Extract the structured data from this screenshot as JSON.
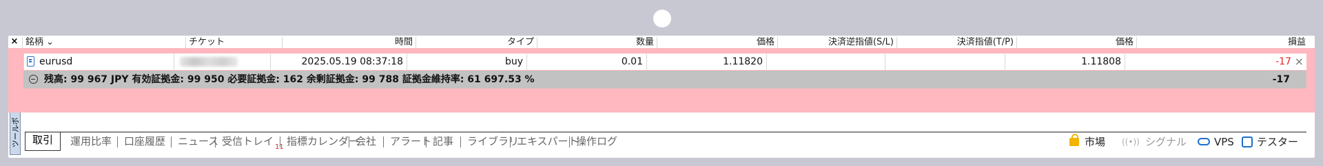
{
  "window": {
    "close_label": "×",
    "side_tab_label": "ツールボ"
  },
  "columns": [
    {
      "label": "銘柄 ⌄",
      "align": "left"
    },
    {
      "label": "チケット",
      "align": "left"
    },
    {
      "label": "時間",
      "align": "right"
    },
    {
      "label": "タイプ",
      "align": "right"
    },
    {
      "label": "数量",
      "align": "right"
    },
    {
      "label": "価格",
      "align": "right"
    },
    {
      "label": "決済逆指値(S/L)",
      "align": "right"
    },
    {
      "label": "決済指値(T/P)",
      "align": "right"
    },
    {
      "label": "価格",
      "align": "right"
    },
    {
      "label": "損益",
      "align": "right"
    }
  ],
  "position": {
    "symbol": "eurusd",
    "time": "2025.05.19 08:37:18",
    "type": "buy",
    "volume": "0.01",
    "open_price": "1.11820",
    "sl": "",
    "tp": "",
    "current_price": "1.11808",
    "profit": "-17",
    "close_label": "×"
  },
  "summary": {
    "text": "残高: 99 967 JPY  有効証拠金: 99 950  必要証拠金: 162  余剰証拠金: 99 788  証拠金維持率: 61 697.53 %",
    "total": "-17"
  },
  "tabs": [
    {
      "label": "取引",
      "active": true
    },
    {
      "label": "運用比率"
    },
    {
      "label": "口座履歴"
    },
    {
      "label": "ニュース"
    },
    {
      "label": "受信トレイ",
      "badge": "11"
    },
    {
      "label": "指標カレンダー"
    },
    {
      "label": "会社"
    },
    {
      "label": "アラート"
    },
    {
      "label": "記事"
    },
    {
      "label": "ライブラリ"
    },
    {
      "label": "エキスパート"
    },
    {
      "label": "操作ログ"
    }
  ],
  "right_tools": {
    "market": "市場",
    "signal": "シグナル",
    "vps": "VPS",
    "tester": "テスター"
  },
  "colors": {
    "highlight": "#ffb8c0",
    "loss": "#e2262a",
    "accent": "#1b6fcc"
  }
}
